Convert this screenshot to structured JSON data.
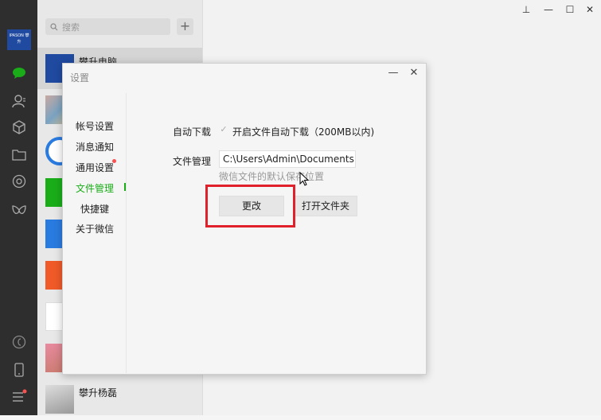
{
  "sidebar": {
    "logo_text": "IPASON 攀升",
    "icons": [
      "chat-icon",
      "contacts-icon",
      "box-icon",
      "folder-icon",
      "moments-icon",
      "miniprogram-icon",
      "settings-icon",
      "phone-icon",
      "menu-icon"
    ]
  },
  "chatlist": {
    "search_placeholder": "搜索",
    "add_label": "+",
    "chats": [
      {
        "name": "攀升电脑"
      },
      {
        "name": ""
      },
      {
        "name": ""
      },
      {
        "name": ""
      },
      {
        "name": ""
      },
      {
        "name": ""
      },
      {
        "name": ""
      },
      {
        "name": ""
      },
      {
        "name": "攀升杨磊"
      }
    ]
  },
  "dialog": {
    "title": "设置",
    "minimize_label": "—",
    "close_label": "✕",
    "nav": [
      {
        "label": "帐号设置"
      },
      {
        "label": "消息通知"
      },
      {
        "label": "通用设置"
      },
      {
        "label": "文件管理"
      },
      {
        "label": "快捷键"
      },
      {
        "label": "关于微信"
      }
    ],
    "auto_download_label": "自动下载",
    "auto_download_option": "开启文件自动下载（200MB以内)",
    "file_manage_label": "文件管理",
    "path_value": "C:\\Users\\Admin\\Documents",
    "hint": "微信文件的默认保存位置",
    "change_button": "更改",
    "open_folder_button": "打开文件夹"
  },
  "window_controls": {
    "pin": "⊥",
    "minimize": "—",
    "maximize": "☐",
    "close": "✕"
  },
  "colors": {
    "accent_green": "#1aad19",
    "highlight_red": "#e0202a",
    "sidebar_bg": "#2e2e2e"
  }
}
